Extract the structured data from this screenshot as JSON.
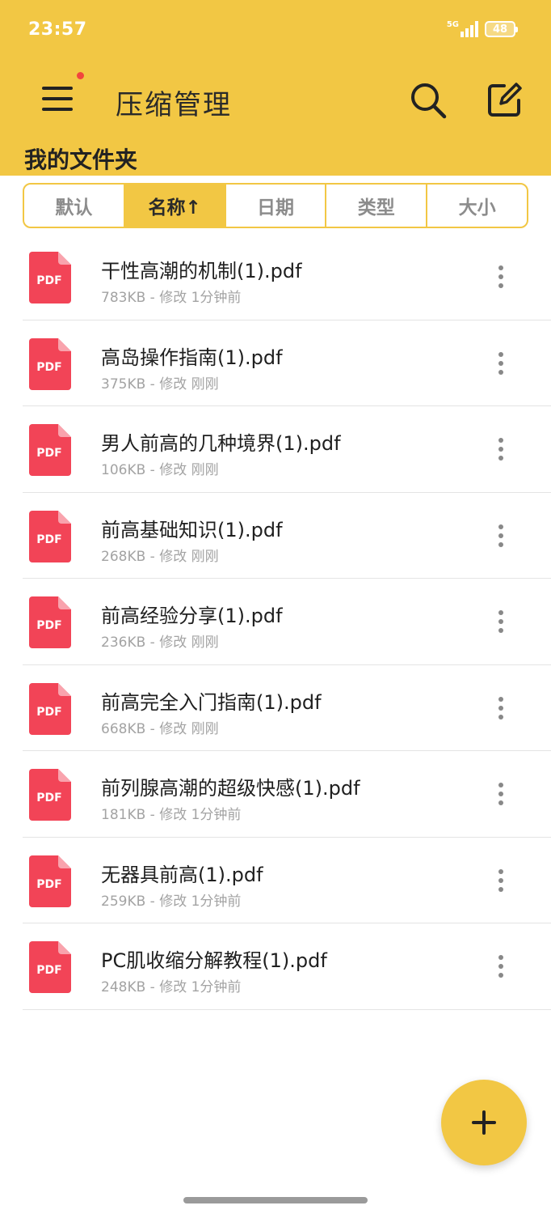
{
  "status_bar": {
    "time": "23:57",
    "network": "5G",
    "battery": "48"
  },
  "header": {
    "title": "压缩管理",
    "folder_title": "我的文件夹"
  },
  "sort_tabs": [
    {
      "label": "默认",
      "active": false
    },
    {
      "label": "名称↑",
      "active": true
    },
    {
      "label": "日期",
      "active": false
    },
    {
      "label": "类型",
      "active": false
    },
    {
      "label": "大小",
      "active": false
    }
  ],
  "files": [
    {
      "name": "干性高潮的机制(1).pdf",
      "meta": "783KB - 修改 1分钟前"
    },
    {
      "name": "高岛操作指南(1).pdf",
      "meta": "375KB - 修改 刚刚"
    },
    {
      "name": "男人前高的几种境界(1).pdf",
      "meta": "106KB - 修改 刚刚"
    },
    {
      "name": "前高基础知识(1).pdf",
      "meta": "268KB - 修改 刚刚"
    },
    {
      "name": "前高经验分享(1).pdf",
      "meta": "236KB - 修改 刚刚"
    },
    {
      "name": "前高完全入门指南(1).pdf",
      "meta": "668KB - 修改 刚刚"
    },
    {
      "name": "前列腺高潮的超级快感(1).pdf",
      "meta": "181KB - 修改 1分钟前"
    },
    {
      "name": "无器具前高(1).pdf",
      "meta": "259KB - 修改 1分钟前"
    },
    {
      "name": "PC肌收缩分解教程(1).pdf",
      "meta": "248KB - 修改 1分钟前"
    }
  ],
  "file_icon_label": "PDF",
  "icons": {
    "menu": "hamburger-menu-icon",
    "search": "search-icon",
    "edit": "edit-icon",
    "more": "more-vertical-icon",
    "fab": "plus-icon",
    "file": "pdf-file-icon"
  },
  "colors": {
    "brand": "#f2c744",
    "pdf": "#f24457",
    "badge": "#f2453d"
  }
}
